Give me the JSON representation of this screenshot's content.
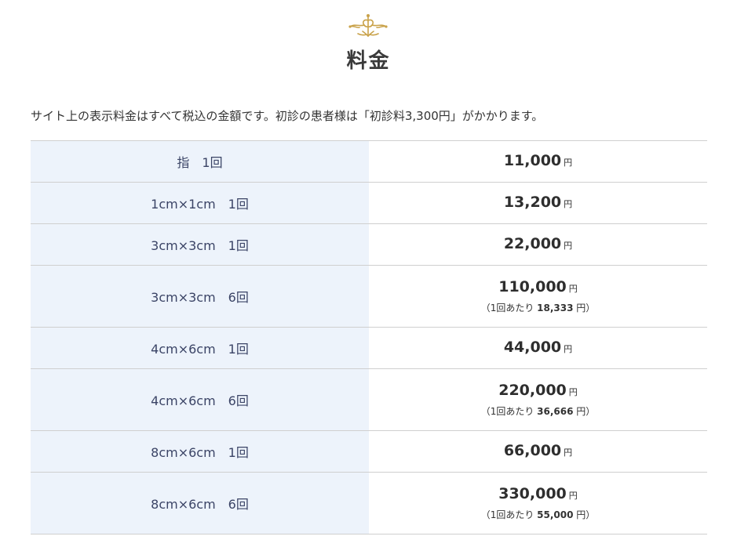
{
  "header": {
    "title": "料金",
    "ornament_icon": "fleur-de-lis-icon",
    "accent_color": "#c9a24a"
  },
  "note": "サイト上の表示料金はすべて税込の金額です。初診の患者様は「初診料3,300円」がかかります。",
  "price_table": {
    "label_bg_color": "#edf3fb",
    "rows": [
      {
        "label": "指　1回",
        "price": "11,000",
        "unit": "円"
      },
      {
        "label": "1cm×1cm　1回",
        "price": "13,200",
        "unit": "円"
      },
      {
        "label": "3cm×3cm　1回",
        "price": "22,000",
        "unit": "円"
      },
      {
        "label": "3cm×3cm　6回",
        "price": "110,000",
        "unit": "円",
        "per_prefix": "（1回あたり ",
        "per_value": "18,333",
        "per_suffix": " 円）"
      },
      {
        "label": "4cm×6cm　1回",
        "price": "44,000",
        "unit": "円"
      },
      {
        "label": "4cm×6cm　6回",
        "price": "220,000",
        "unit": "円",
        "per_prefix": "（1回あたり ",
        "per_value": "36,666",
        "per_suffix": " 円）"
      },
      {
        "label": "8cm×6cm　1回",
        "price": "66,000",
        "unit": "円"
      },
      {
        "label": "8cm×6cm　6回",
        "price": "330,000",
        "unit": "円",
        "per_prefix": "（1回あたり ",
        "per_value": "55,000",
        "per_suffix": " 円）"
      }
    ]
  }
}
